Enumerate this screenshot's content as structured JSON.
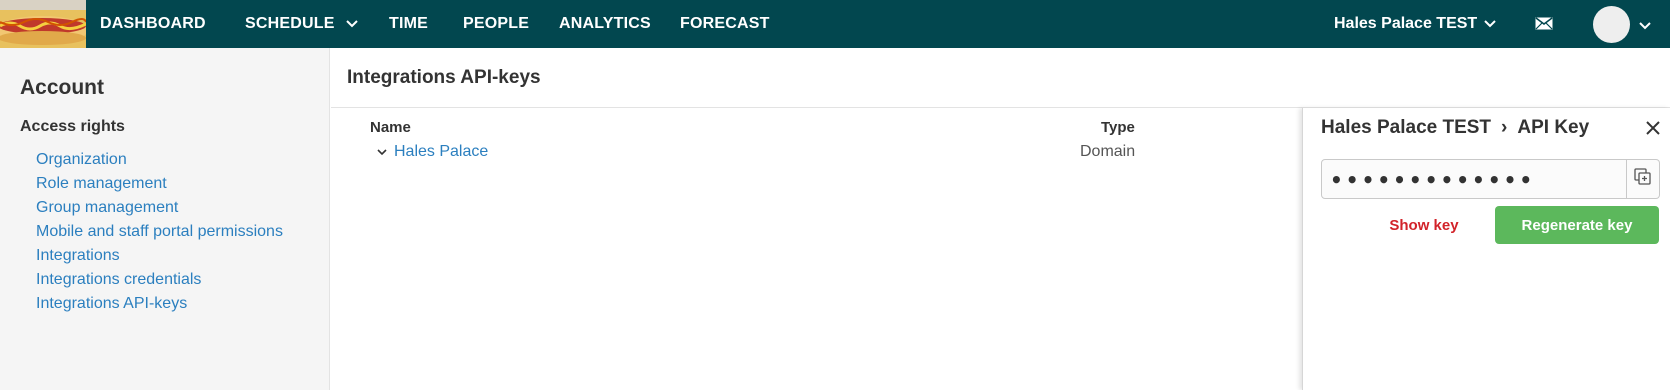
{
  "nav": {
    "items": [
      {
        "label": "DASHBOARD"
      },
      {
        "label": "SCHEDULE"
      },
      {
        "label": "TIME"
      },
      {
        "label": "PEOPLE"
      },
      {
        "label": "ANALYTICS"
      },
      {
        "label": "FORECAST"
      }
    ],
    "site_selector": "Hales Palace TEST",
    "icons": {
      "mail": "mail-icon",
      "avatar": "avatar",
      "chevron": "chevron-down-icon"
    },
    "colors": {
      "bar": "#02474f",
      "text": "#ffffff"
    }
  },
  "sidebar": {
    "heading": "Account",
    "section": "Access rights",
    "items": [
      {
        "label": "Organization"
      },
      {
        "label": "Role management"
      },
      {
        "label": "Group management"
      },
      {
        "label": "Mobile and staff portal permissions"
      },
      {
        "label": "Integrations"
      },
      {
        "label": "Integrations credentials"
      },
      {
        "label": "Integrations API-keys"
      }
    ]
  },
  "main": {
    "title": "Integrations API-keys",
    "columns": {
      "name": "Name",
      "type": "Type"
    },
    "rows": [
      {
        "name": "Hales Palace",
        "type": "Domain"
      }
    ]
  },
  "panel": {
    "breadcrumb_site": "Hales Palace TEST",
    "breadcrumb_sep": "›",
    "breadcrumb_page": "API Key",
    "key_value": "•••••••••••••",
    "show_key_label": "Show key",
    "regenerate_label": "Regenerate key",
    "colors": {
      "danger": "#d2232a",
      "success": "#5cb85c",
      "link": "#2b7fbf"
    }
  }
}
